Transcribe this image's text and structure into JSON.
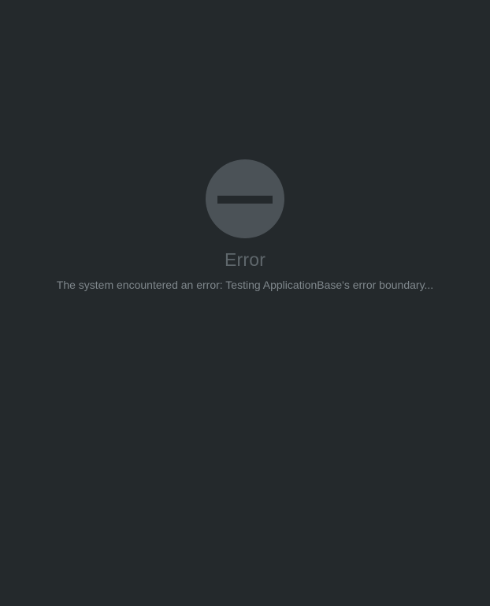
{
  "error": {
    "icon": "no-entry-icon",
    "title": "Error",
    "message": "The system encountered an error: Testing ApplicationBase's error boundary..."
  },
  "colors": {
    "background": "#24292c",
    "icon": "#4b5257",
    "title": "#5f676c",
    "message": "#7f878c"
  }
}
